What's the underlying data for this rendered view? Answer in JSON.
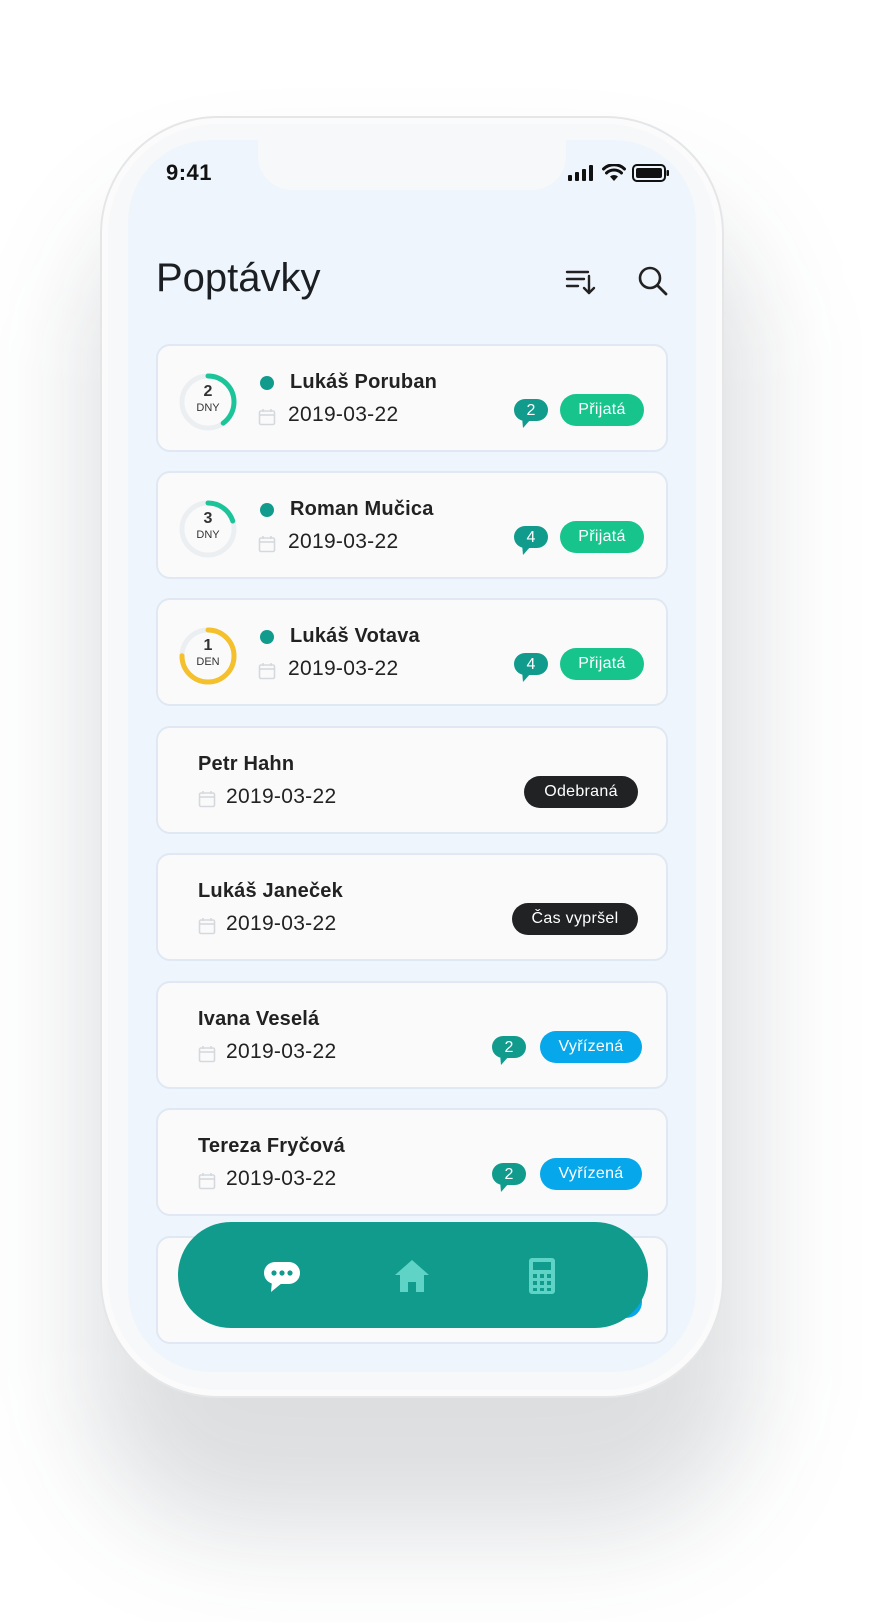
{
  "status_bar": {
    "time": "9:41"
  },
  "header": {
    "title": "Poptávky",
    "sort_icon": "sort-icon",
    "search_icon": "search-icon"
  },
  "colors": {
    "accent": "#119b8d",
    "accepted": "#17c58c",
    "done": "#07a7ec",
    "dark": "#202224",
    "ring_green": "#1cc49a",
    "ring_yellow": "#f4c02c"
  },
  "requests": [
    {
      "name": "Lukáš Poruban",
      "date": "2019-03-22",
      "countdown_value": "2",
      "countdown_unit": "DNY",
      "countdown_progress": 0.4,
      "messages": "2",
      "status": "Přijatá"
    },
    {
      "name": "Roman Mučica",
      "date": "2019-03-22",
      "countdown_value": "3",
      "countdown_unit": "DNY",
      "countdown_progress": 0.2,
      "messages": "4",
      "status": "Přijatá"
    },
    {
      "name": "Lukáš Votava",
      "date": "2019-03-22",
      "countdown_value": "1",
      "countdown_unit": "DEN",
      "countdown_progress": 0.75,
      "messages": "4",
      "status": "Přijatá"
    },
    {
      "name": "Petr Hahn",
      "date": "2019-03-22",
      "status": "Odebraná"
    },
    {
      "name": "Lukáš Janeček",
      "date": "2019-03-22",
      "status": "Čas vypršel"
    },
    {
      "name": "Ivana Veselá",
      "date": "2019-03-22",
      "messages": "2",
      "status": "Vyřízená"
    },
    {
      "name": "Tereza Fryčová",
      "date": "2019-03-22",
      "messages": "2",
      "status": "Vyřízená"
    }
  ],
  "bottom_nav": {
    "items": [
      {
        "icon": "chat-icon",
        "active": true
      },
      {
        "icon": "home-icon",
        "active": false
      },
      {
        "icon": "calculator-icon",
        "active": false
      }
    ]
  }
}
